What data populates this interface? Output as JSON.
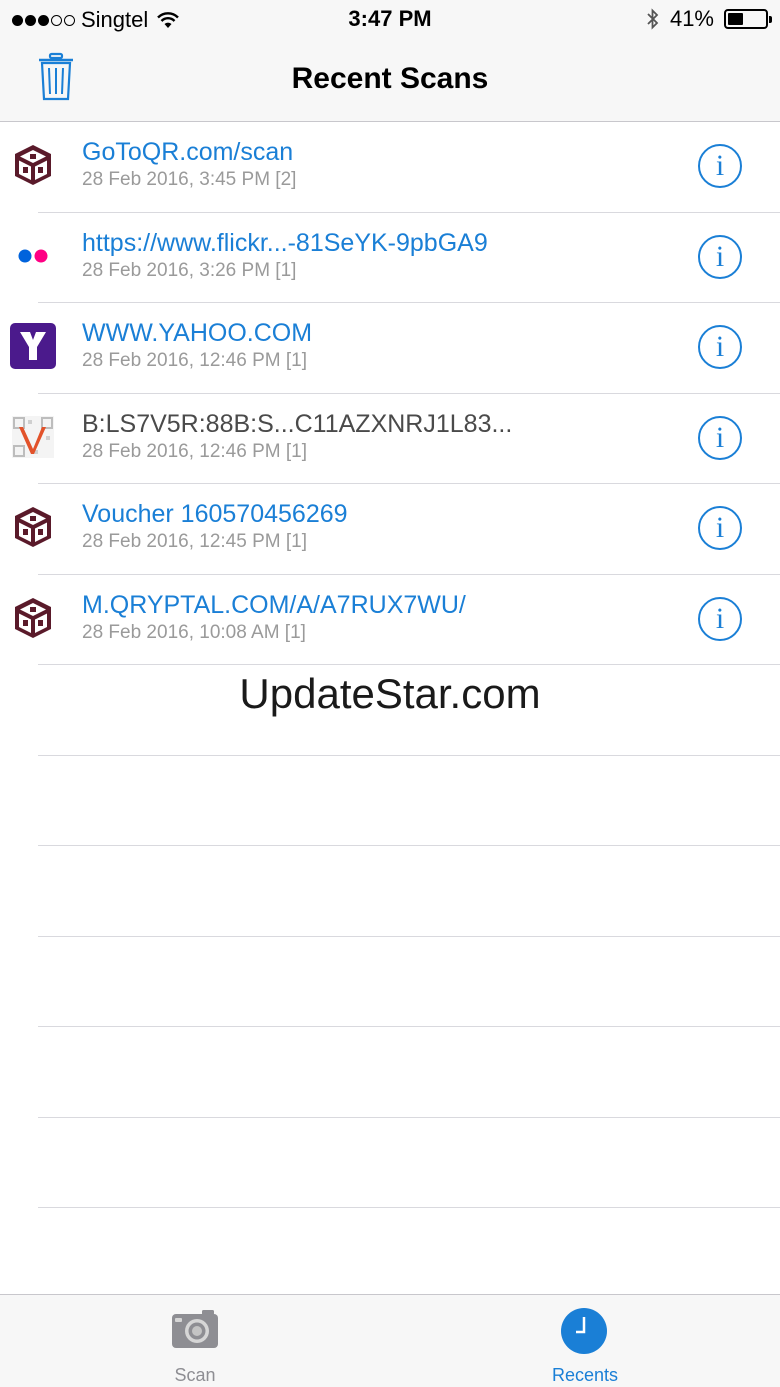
{
  "status_bar": {
    "carrier": "Singtel",
    "time": "3:47 PM",
    "battery": "41%",
    "battery_level": 0.41
  },
  "nav": {
    "title": "Recent Scans",
    "trash_icon": "trash-icon"
  },
  "scans": [
    {
      "title": "GoToQR.com/scan",
      "subtitle": "28 Feb 2016, 3:45 PM [2]",
      "icon": "qr-cube-icon",
      "link": true
    },
    {
      "title": "https://www.flickr...-81SeYK-9pbGA9",
      "subtitle": "28 Feb 2016, 3:26 PM [1]",
      "icon": "flickr-icon",
      "link": true
    },
    {
      "title": "WWW.YAHOO.COM",
      "subtitle": "28 Feb 2016, 12:46 PM [1]",
      "icon": "yahoo-icon",
      "link": true
    },
    {
      "title": "B:LS7V5R:88B:S...C11AZXNRJ1L83...",
      "subtitle": "28 Feb 2016, 12:46 PM [1]",
      "icon": "vcard-qr-icon",
      "link": false
    },
    {
      "title": "Voucher 160570456269",
      "subtitle": "28 Feb 2016, 12:45 PM [1]",
      "icon": "qr-cube-icon",
      "link": true
    },
    {
      "title": "M.QRYPTAL.COM/A/A7RUX7WU/",
      "subtitle": "28 Feb 2016, 10:08 AM [1]",
      "icon": "qr-cube-icon",
      "link": true
    }
  ],
  "info_glyph": "i",
  "watermark": "UpdateStar.com",
  "tabs": {
    "scan": "Scan",
    "recents": "Recents"
  },
  "colors": {
    "accent": "#1a7fd6",
    "cube": "#5a1a2a",
    "yahoo": "#4b1a8c",
    "flickr_blue": "#0063dc",
    "flickr_pink": "#ff0084"
  }
}
